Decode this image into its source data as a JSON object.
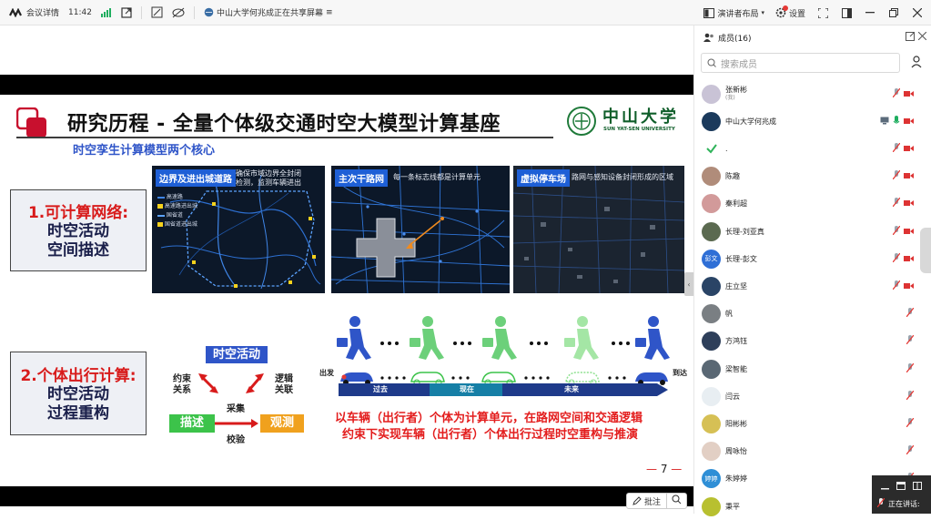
{
  "topbar": {
    "meeting_details": "会议详情",
    "time": "11:42",
    "sharing_status": "中山大学何兆成正在共享屏幕",
    "presenter_layout": "演讲者布局",
    "settings": "设置"
  },
  "slide": {
    "title": "研究历程 - 全量个体级交通时空大模型计算基座",
    "subtitle": "时空孪生计算模型两个核心",
    "university_cn": "中山大学",
    "university_en": "SUN YAT-SEN UNIVERSITY",
    "box1": {
      "line1": "1.可计算网络:",
      "line2": "时空活动",
      "line3": "空间描述"
    },
    "box2": {
      "line1": "2.个体出行计算:",
      "line2": "时空活动",
      "line3": "过程重构"
    },
    "map1": {
      "tag": "边界及进出城道路",
      "desc1": "确保市域边界全封闭",
      "desc2": "检测，监测车辆进出",
      "legend": [
        "高速路",
        "高速路进出城",
        "国省道",
        "国省道进出城"
      ]
    },
    "map2": {
      "tag": "主次干路网",
      "desc": "每一条标志线都是计算单元"
    },
    "map3": {
      "tag": "虚拟停车场",
      "desc": "路网与感知设备封闭形成的区域"
    },
    "diagram": {
      "center": "时空活动",
      "left_top": "约束",
      "left_bottom": "关系",
      "right_top": "逻辑",
      "right_bottom": "关联",
      "mid_top": "采集",
      "mid_bottom": "校验",
      "describe": "描述",
      "observe": "观测"
    },
    "timeline": {
      "depart": "出发",
      "arrive": "到达",
      "past": "过去",
      "now": "现在",
      "future": "未来"
    },
    "bottom_line1": "以车辆（出行者）个体为计算单元，在路网空间和交通逻辑",
    "bottom_line2": "约束下实现车辆（出行者）个体出行过程时空重构与推演",
    "page_number": "7"
  },
  "annotate": "批注",
  "panel": {
    "title": "成员(16)",
    "search_placeholder": "搜索成员",
    "members": [
      {
        "name": "张新彬",
        "sub": "(我)",
        "color": "#c9c3d6"
      },
      {
        "name": "中山大学何兆成",
        "sub": "",
        "color": "#1b3a5c"
      },
      {
        "name": ".",
        "sub": "",
        "color": "#ffffff"
      },
      {
        "name": "陈趣",
        "sub": "",
        "color": "#b08c7a"
      },
      {
        "name": "秦利超",
        "sub": "",
        "color": "#d29a9a"
      },
      {
        "name": "长理-刘亚真",
        "sub": "",
        "color": "#5b6a50"
      },
      {
        "name": "长理-彭文",
        "sub": "",
        "color": "#2f6fd6",
        "initials": "彭文"
      },
      {
        "name": "庄立坚",
        "sub": "",
        "color": "#2a4466"
      },
      {
        "name": "帆",
        "sub": "",
        "color": "#7a7f83"
      },
      {
        "name": "方鸿钰",
        "sub": "",
        "color": "#2e3f5a"
      },
      {
        "name": "梁智能",
        "sub": "",
        "color": "#5a6874"
      },
      {
        "name": "闫云",
        "sub": "",
        "color": "#e8eef2"
      },
      {
        "name": "阳彬彬",
        "sub": "",
        "color": "#d6c055"
      },
      {
        "name": "周咏怡",
        "sub": "",
        "color": "#e2cfc4"
      },
      {
        "name": "朱婷婷",
        "sub": "",
        "color": "#2f8fd6",
        "initials": "婷婷"
      },
      {
        "name": "秉平",
        "sub": "",
        "color": "#b8c030"
      }
    ]
  },
  "float": {
    "talking": "正在讲话:"
  },
  "colors": {
    "accent_blue": "#2f55c8",
    "slide_red": "#d81b1b",
    "mic_muted": "#e53935",
    "mic_on": "#1fae5f"
  }
}
